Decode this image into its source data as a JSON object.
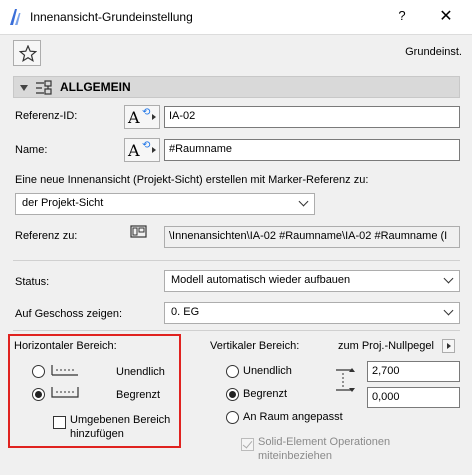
{
  "window": {
    "title": "Innenansicht-Grundeinstellung",
    "help_label": "?",
    "close_label": "✕"
  },
  "preset_label": "Grundeinst.",
  "section": {
    "title": "ALLGEMEIN"
  },
  "reference_id": {
    "label": "Referenz-ID:",
    "value": "IA-02"
  },
  "name": {
    "label": "Name:",
    "value": "#Raumname"
  },
  "create_prompt": "Eine neue Innenansicht (Projekt-Sicht) erstellen mit Marker-Referenz zu:",
  "marker_ref_select": "der Projekt-Sicht",
  "reference_to": {
    "label": "Referenz zu:",
    "value": "\\Innenansichten\\IA-02 #Raumname\\IA-02 #Raumname (I"
  },
  "status": {
    "label": "Status:",
    "value": "Modell automatisch wieder aufbauen"
  },
  "floor": {
    "label": "Auf Geschoss zeigen:",
    "value": "0. EG"
  },
  "horizontal": {
    "title": "Horizontaler Bereich:",
    "options": [
      "Unendlich",
      "Begrenzt"
    ],
    "selected": "Begrenzt",
    "checkbox_line1": "Umgebenen Bereich",
    "checkbox_line2": "hinzufügen",
    "checkbox_checked": false
  },
  "vertical": {
    "title": "Vertikaler Bereich:",
    "datum_label": "zum Proj.-Nullpegel",
    "options": [
      "Unendlich",
      "Begrenzt",
      "An Raum angepasst"
    ],
    "selected": "Begrenzt",
    "top_value": "2,700",
    "bottom_value": "0,000",
    "solid_line1": "Solid-Element Operationen",
    "solid_line2": "miteinbeziehen",
    "solid_checked": true
  },
  "icons": [
    "app-icon",
    "star-icon",
    "settings-section-icon",
    "reference-field-icon",
    "layout-icon",
    "horizontal-range-icon",
    "vertical-range-icon"
  ],
  "colors": {
    "highlight_box": "#e0221f",
    "section_header": "#d9d9d9",
    "dialog_bg": "#f0f0f0"
  }
}
